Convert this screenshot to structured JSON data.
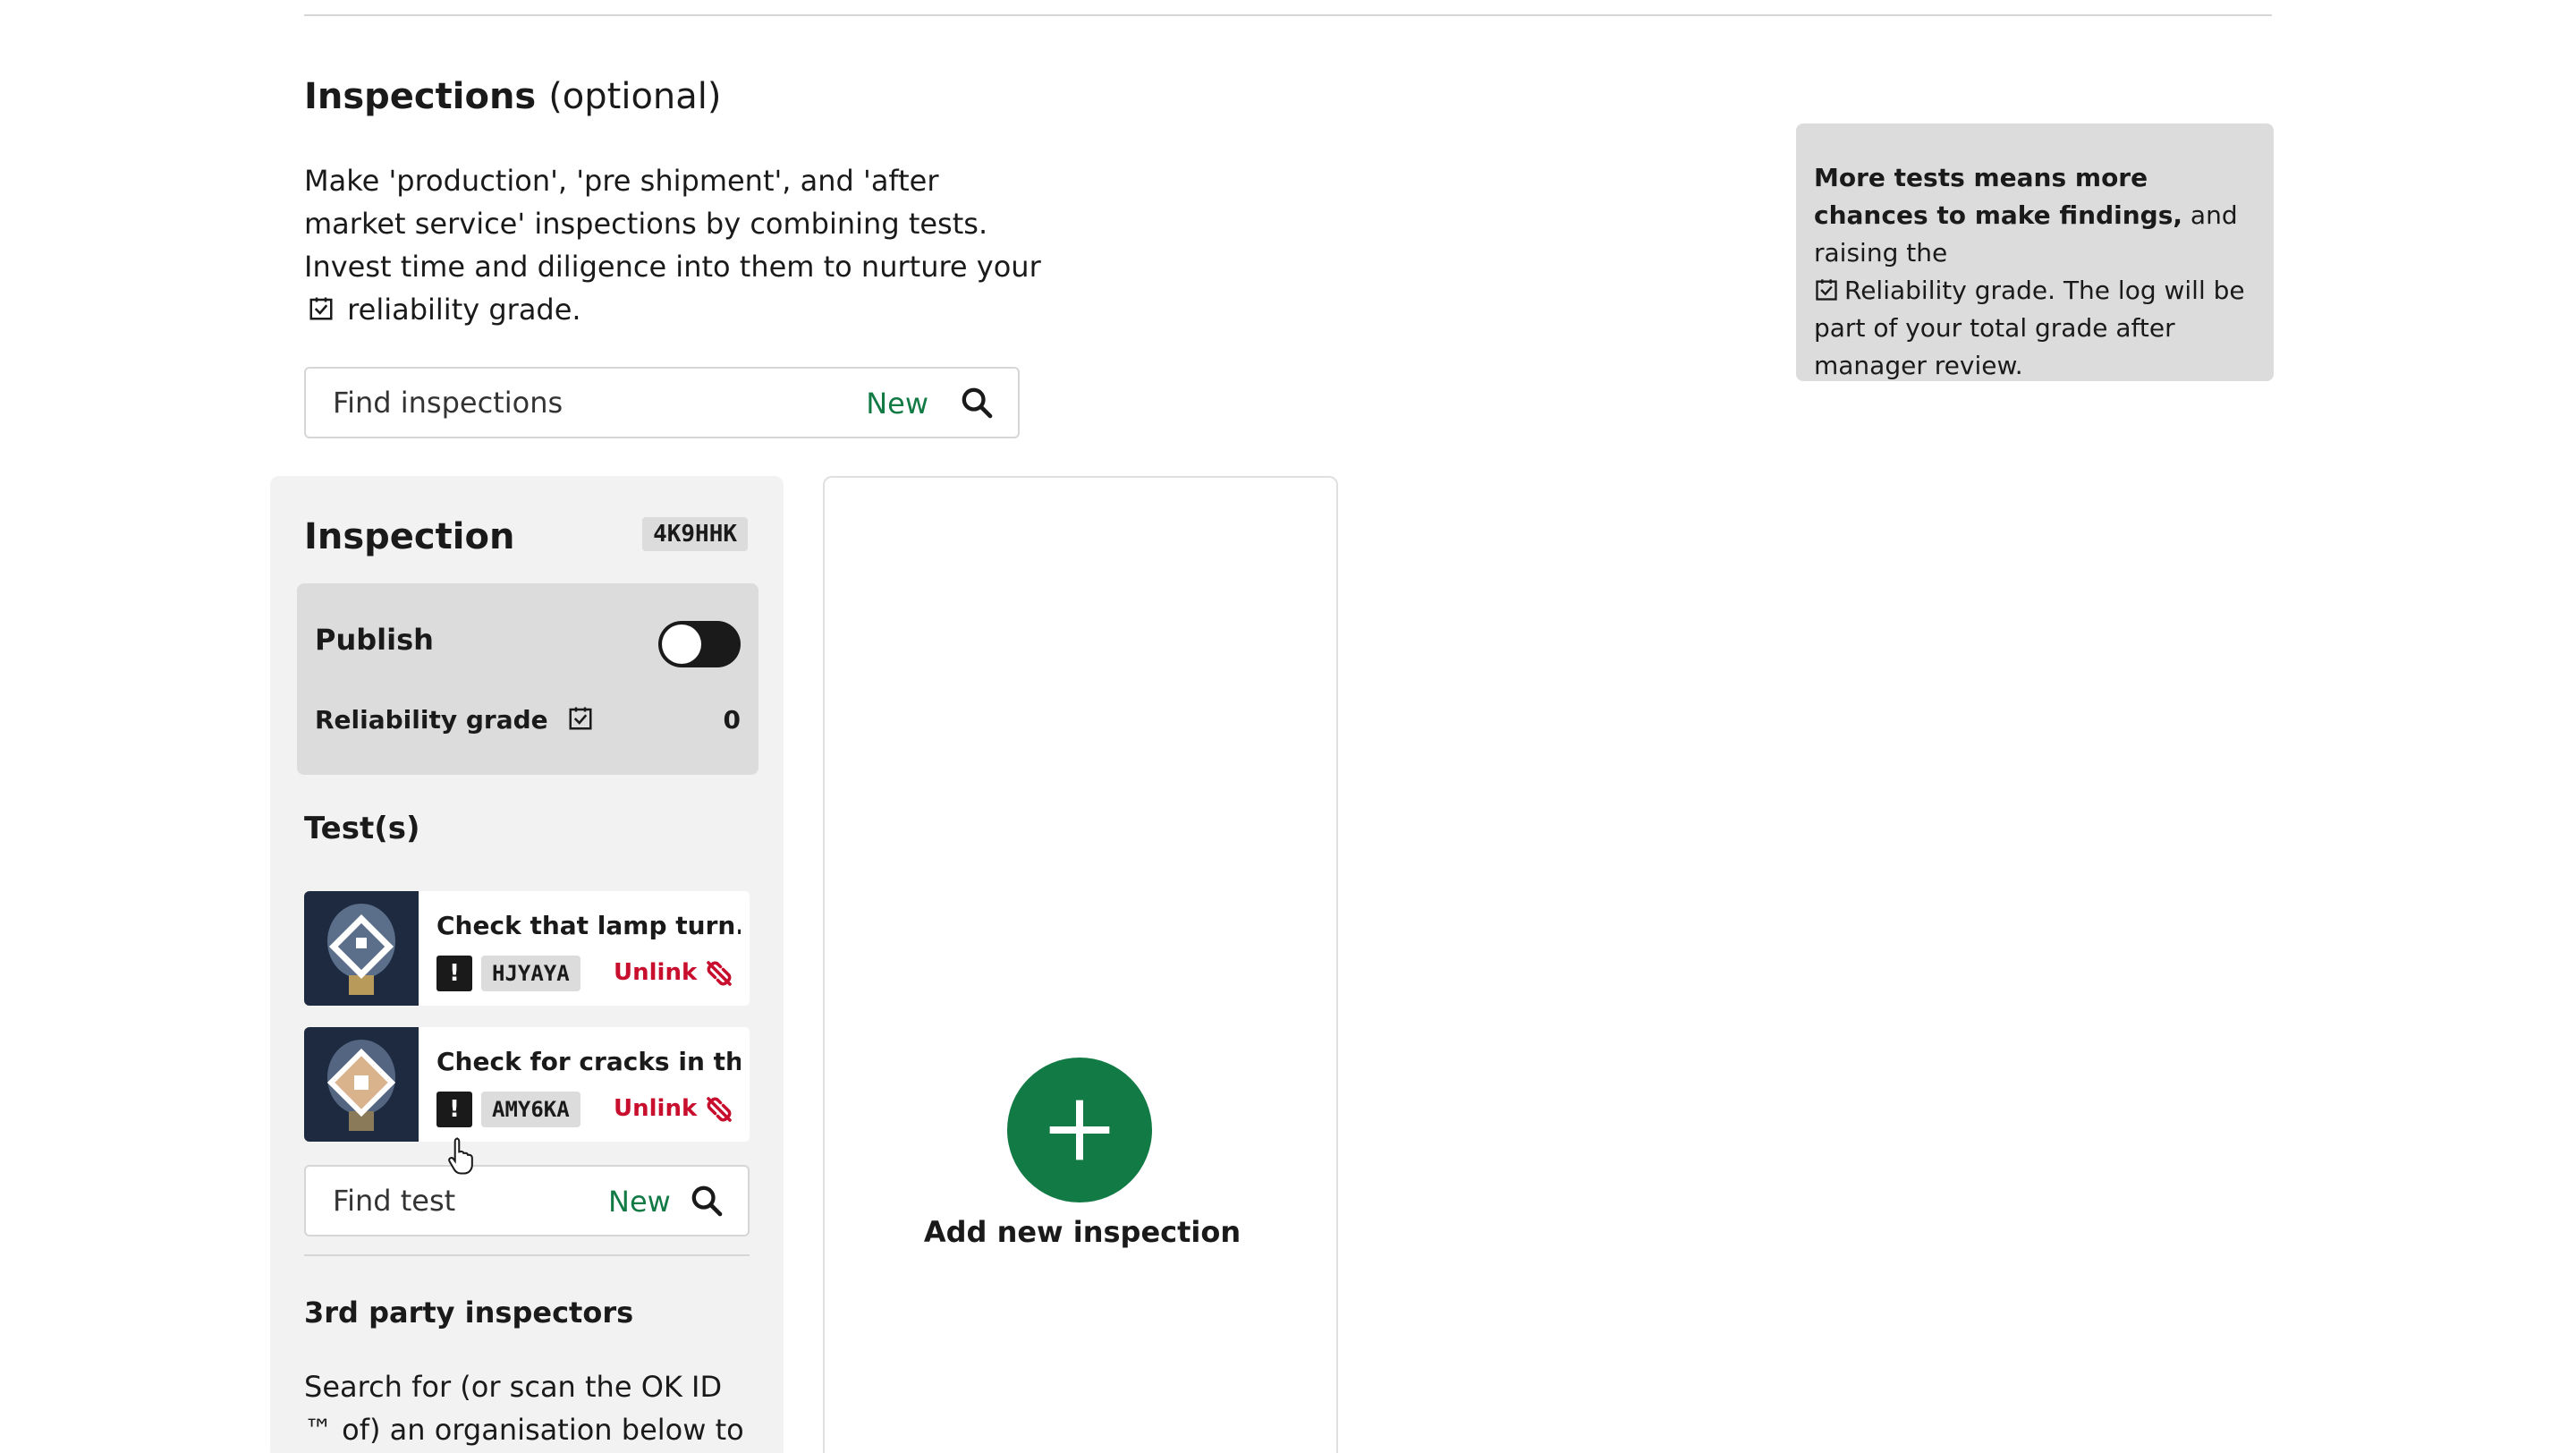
{
  "section": {
    "title": "Inspections",
    "title_suffix": "(optional)",
    "intro_before": "Make 'production', 'pre shipment', and 'after market service' inspections by combining tests. Invest time and diligence into them to nurture your",
    "intro_after": "reliability grade.",
    "search_placeholder": "Find inspections",
    "search_new": "New"
  },
  "tip": {
    "bold": "More tests means more chances to make findings,",
    "text1": " and raising the",
    "text2": "Reliability grade. The log will be part of your total grade after manager review."
  },
  "inspection": {
    "title": "Inspection",
    "code": "4K9HHK",
    "publish_label": "Publish",
    "publish_on": false,
    "grade_label": "Reliability grade",
    "grade_value": "0",
    "tests_title": "Test(s)",
    "tests": [
      {
        "title": "Check that lamp turn...",
        "code": "HJYAYA",
        "warn": "!",
        "unlink": "Unlink",
        "thumb_icon": "lamp-thumbnail-icon"
      },
      {
        "title": "Check for cracks in th...",
        "code": "AMY6KA",
        "warn": "!",
        "unlink": "Unlink",
        "thumb_icon": "lamp-thumbnail-icon"
      }
    ],
    "find_test_placeholder": "Find test",
    "find_test_new": "New",
    "third_party_title": "3rd party inspectors",
    "third_party_text": "Search for (or scan the OK ID ™ of) an organisation below to"
  },
  "add_inspection": {
    "label": "Add new inspection"
  },
  "colors": {
    "accent_green": "#117a45",
    "danger_red": "#c8102e",
    "panel_gray": "#f2f2f2",
    "box_gray": "#dcdcdc"
  }
}
